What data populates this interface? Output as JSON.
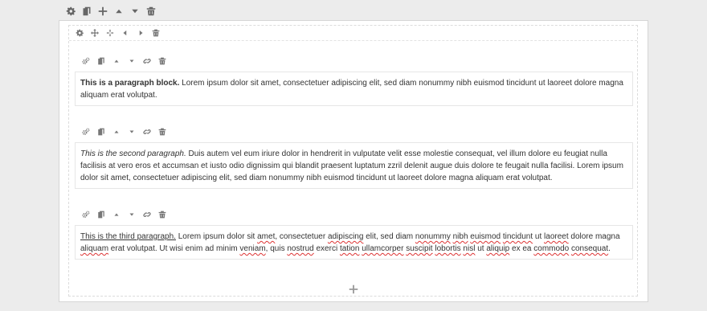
{
  "top_toolbar": {
    "icons": [
      "gear-icon",
      "duplicate-icon",
      "plus-icon",
      "caret-up-icon",
      "caret-down-icon",
      "trash-icon"
    ]
  },
  "column_toolbar": {
    "icons": [
      "gear-icon",
      "move-icon",
      "resize-icon",
      "chevron-left-icon",
      "chevron-right-icon",
      "trash-icon"
    ]
  },
  "block_toolbar": {
    "icons": [
      "cogs-icon",
      "duplicate-icon",
      "caret-up-icon",
      "caret-down-icon",
      "link-icon",
      "trash-icon"
    ]
  },
  "blocks": [
    {
      "lead": "This is a paragraph block.",
      "lead_style": "bold",
      "body": " Lorem ipsum dolor sit amet, consectetuer adipiscing elit, sed diam nonummy nibh euismod tincidunt ut laoreet dolore magna aliquam erat volutpat."
    },
    {
      "lead": "This is the second paragraph.",
      "lead_style": "italic",
      "body": " Duis autem vel eum iriure dolor in hendrerit in vulputate velit esse molestie consequat, vel illum dolore eu feugiat nulla facilisis at vero eros et accumsan et iusto odio dignissim qui blandit praesent luptatum zzril delenit augue duis dolore te feugait nulla facilisi. Lorem ipsum dolor sit amet, consectetuer adipiscing elit, sed diam nonummy nibh euismod tincidunt ut laoreet dolore magna aliquam erat volutpat."
    },
    {
      "lead": "This is the third paragraph.",
      "lead_style": "underline",
      "body_parts": [
        " Lorem ipsum dolor sit ",
        "amet",
        ", consectetuer ",
        "adipiscing",
        " elit, sed diam ",
        "nonummy",
        " ",
        "nibh",
        " ",
        "euismod",
        " ",
        "tincidunt",
        " ut ",
        "laoreet",
        " dolore magna ",
        "aliquam",
        " erat volutpat. Ut wisi enim ad minim ",
        "veniam",
        ", quis ",
        "nostrud",
        " exerci ",
        "tation",
        " ",
        "ullamcorper",
        " ",
        "suscipit",
        " ",
        "lobortis",
        " ",
        "nisl",
        " ut ",
        "aliquip",
        " ex ea ",
        "commodo",
        " ",
        "consequat",
        "."
      ]
    }
  ],
  "add_block_icon": "plus-icon"
}
